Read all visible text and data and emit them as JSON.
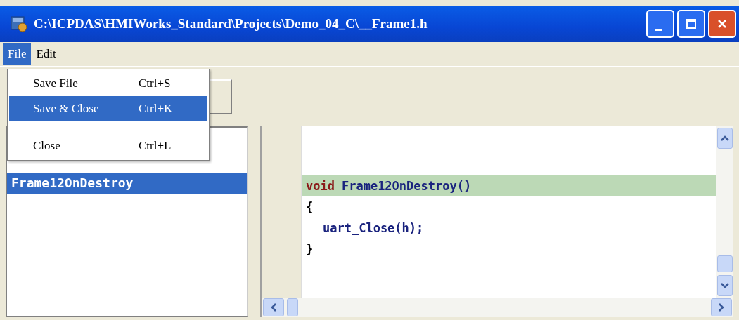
{
  "window": {
    "title": "C:\\ICPDAS\\HMIWorks_Standard\\Projects\\Demo_04_C\\__Frame1.h"
  },
  "menu_bar": [
    {
      "label": "File",
      "selected": true
    },
    {
      "label": "Edit",
      "selected": false
    }
  ],
  "file_menu": [
    {
      "kind": "item",
      "label": "Save File",
      "shortcut": "Ctrl+S",
      "selected": false
    },
    {
      "kind": "item",
      "label": "Save & Close",
      "shortcut": "Ctrl+K",
      "selected": true
    },
    {
      "kind": "separator"
    },
    {
      "kind": "item",
      "label": "Close",
      "shortcut": "Ctrl+L",
      "selected": false
    }
  ],
  "function_list": [
    {
      "label": "Frame12OnDestroy",
      "selected": true
    }
  ],
  "code_lines": [
    {
      "highlighted": true,
      "indented": false,
      "tokens": [
        {
          "kind": "keyword",
          "text": "void"
        },
        {
          "kind": "plain",
          "text": "Frame12OnDestroy()"
        }
      ]
    },
    {
      "highlighted": false,
      "indented": false,
      "tokens": [
        {
          "kind": "punct",
          "text": "{"
        }
      ]
    },
    {
      "highlighted": false,
      "indented": true,
      "tokens": [
        {
          "kind": "plain",
          "text": "uart_Close(h);"
        }
      ]
    },
    {
      "highlighted": false,
      "indented": false,
      "tokens": [
        {
          "kind": "punct",
          "text": "}"
        }
      ]
    }
  ]
}
